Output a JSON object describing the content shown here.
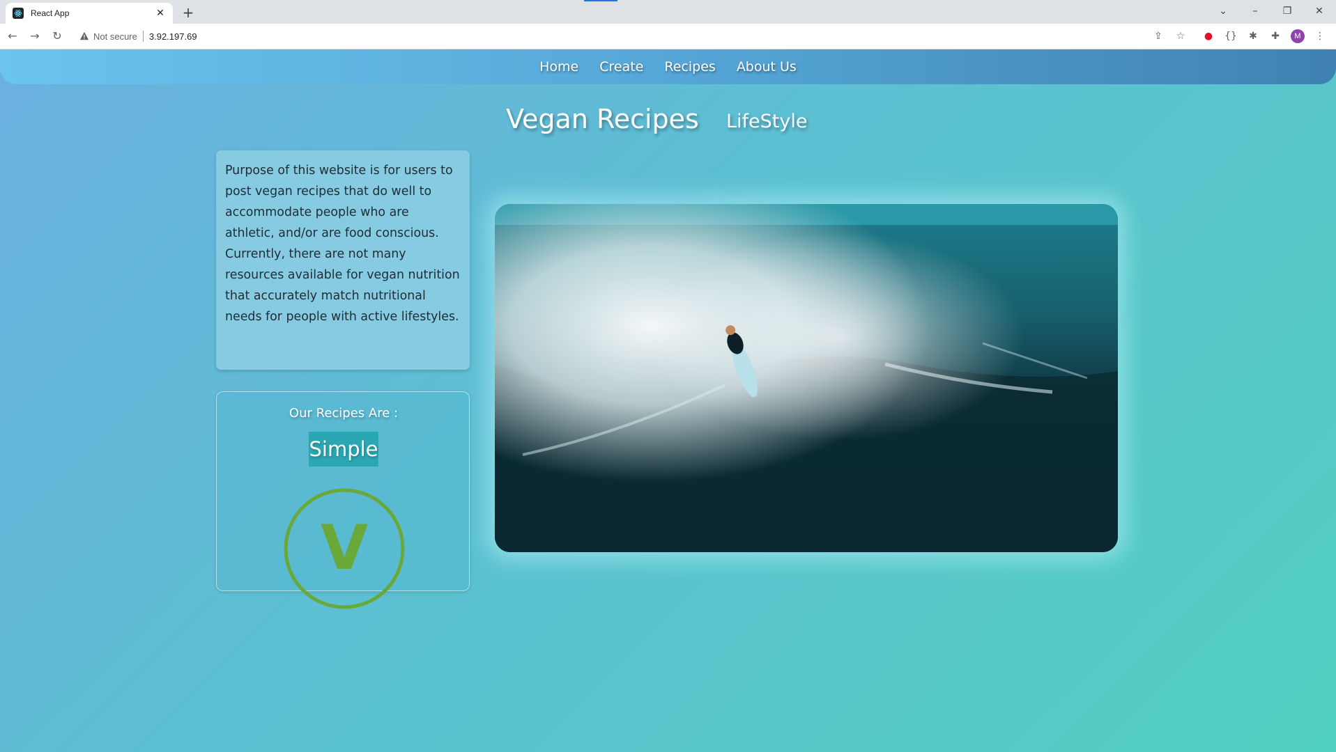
{
  "browser": {
    "tab_title": "React App",
    "tab_close": "✕",
    "new_tab": "+",
    "security_label": "Not secure",
    "url": "3.92.197.69",
    "profile_initial": "M"
  },
  "nav": {
    "links": [
      "Home",
      "Create",
      "Recipes",
      "About Us"
    ]
  },
  "header": {
    "title": "Vegan Recipes",
    "subtitle": "LifeStyle"
  },
  "purpose": {
    "text": "Purpose of this website is for users to post vegan recipes that do well to accommodate people who are athletic, and/or are food conscious. Currently, there are not many resources available for vegan nutrition that accurately match nutritional needs for people with active lifestyles."
  },
  "recipes_card": {
    "heading": "Our Recipes Are :",
    "badge": "Simple",
    "logo_letter": "V"
  },
  "colors": {
    "navbar_start": "#6ac4ee",
    "navbar_end": "#3f82b2",
    "badge": "#2aa7b3",
    "logo_green": "#6aa83a"
  }
}
